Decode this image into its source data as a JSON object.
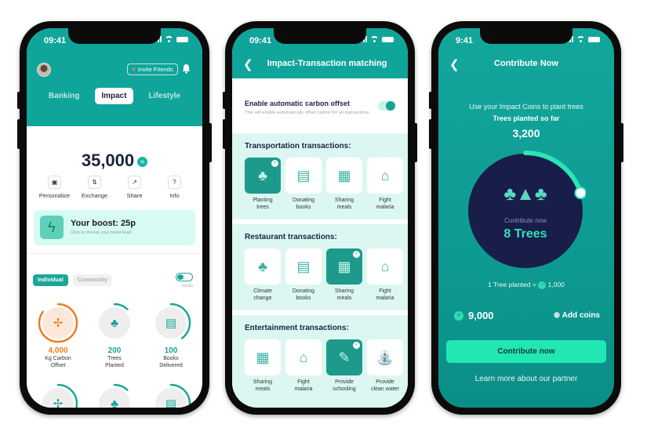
{
  "status_bar": {
    "time_1": "09:41",
    "time_2": "09:41",
    "time_3": "9:41"
  },
  "phone1": {
    "invite_label": "Invite Friends",
    "tabs": [
      {
        "label": "Banking"
      },
      {
        "label": "Impact",
        "active": true
      },
      {
        "label": "Lifestyle"
      }
    ],
    "balance": "35,000",
    "coin_icon": "impact-coin-icon",
    "actions": [
      {
        "label": "Personalize",
        "icon": "personalize-icon"
      },
      {
        "label": "Exchange",
        "icon": "exchange-icon"
      },
      {
        "label": "Share",
        "icon": "share-icon"
      },
      {
        "label": "Info",
        "icon": "info-icon"
      }
    ],
    "boost": {
      "title": "Your boost: 25p",
      "subtitle": "Click to choose your boost level"
    },
    "segments": {
      "individual": "Individual",
      "community": "Community"
    },
    "toggle_label": "circles",
    "stats": [
      {
        "value": "4,000",
        "label_line1": "Kg Carbon",
        "label_line2": "Offset",
        "icon": "wind-turbine-icon",
        "progress": 0.85,
        "color": "#ee7c1e"
      },
      {
        "value": "200",
        "label_line1": "Trees",
        "label_line2": "Planted",
        "icon": "trees-icon",
        "progress": 0.12,
        "color": "#1aa696"
      },
      {
        "value": "100",
        "label_line1": "Books",
        "label_line2": "Delivered",
        "icon": "books-icon",
        "progress": 0.4,
        "color": "#1aa696"
      },
      {
        "value": "",
        "label_line1": "",
        "label_line2": "",
        "icon": "wind-turbine-icon",
        "progress": 0.7,
        "color": "#1aa696"
      },
      {
        "value": "",
        "label_line1": "",
        "label_line2": "",
        "icon": "trees-icon",
        "progress": 0.12,
        "color": "#1aa696"
      },
      {
        "value": "",
        "label_line1": "",
        "label_line2": "",
        "icon": "books-icon",
        "progress": 0.4,
        "color": "#1aa696"
      }
    ]
  },
  "phone2": {
    "title": "Impact-Transaction matching",
    "offset": {
      "title": "Enable automatic carbon offset",
      "subtitle": "This will enable automatically offset carbon for all transactions",
      "enabled": true
    },
    "sections": [
      {
        "title": "Transportation transactions:",
        "items": [
          {
            "line1": "Planting",
            "line2": "trees",
            "selected": true,
            "icon": "trees-icon"
          },
          {
            "line1": "Donating",
            "line2": "books",
            "selected": false,
            "icon": "books-icon"
          },
          {
            "line1": "Sharing",
            "line2": "meals",
            "selected": false,
            "icon": "meal-bag-icon"
          },
          {
            "line1": "Fight",
            "line2": "malaria",
            "selected": false,
            "icon": "tent-icon"
          }
        ]
      },
      {
        "title": "Restaurant transactions:",
        "items": [
          {
            "line1": "Climate",
            "line2": "change",
            "selected": false,
            "icon": "trees-icon"
          },
          {
            "line1": "Donating",
            "line2": "books",
            "selected": false,
            "icon": "books-icon"
          },
          {
            "line1": "Sharing",
            "line2": "meals",
            "selected": true,
            "icon": "meal-bag-icon"
          },
          {
            "line1": "Fight",
            "line2": "malaria",
            "selected": false,
            "icon": "tent-icon"
          }
        ]
      },
      {
        "title": "Entertainment transactions:",
        "items": [
          {
            "line1": "Sharing",
            "line2": "meals",
            "selected": false,
            "icon": "meal-bag-icon"
          },
          {
            "line1": "Fight",
            "line2": "malaria",
            "selected": false,
            "icon": "tent-icon"
          },
          {
            "line1": "Provide",
            "line2": "schooling",
            "selected": true,
            "icon": "pencil-cup-icon"
          },
          {
            "line1": "Provide",
            "line2": "clean water",
            "selected": false,
            "icon": "water-pump-icon"
          }
        ]
      }
    ]
  },
  "phone3": {
    "title": "Contribute Now",
    "intro": "Use your Impact Coins to plant trees",
    "planted_label": "Trees planted so far",
    "planted_value": "3,200",
    "dial": {
      "caption": "Contribute now",
      "amount": "8 Trees",
      "progress": 0.2
    },
    "rate_prefix": "1 Tree planted =",
    "rate_value": "1,000",
    "wallet": "9,000",
    "add_coins": "Add coins",
    "cta": "Contribute now",
    "partner_link": "Learn more about our partner"
  }
}
